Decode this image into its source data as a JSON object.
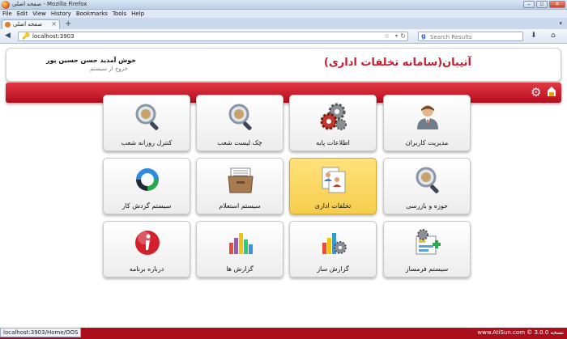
{
  "window": {
    "title": "صفحه اصلی - Mozilla Firefox",
    "minimize": "–",
    "maximize": "▫",
    "close": "✕"
  },
  "menu": [
    "File",
    "Edit",
    "View",
    "History",
    "Bookmarks",
    "Tools",
    "Help"
  ],
  "tab": {
    "label": "صفحه اصلی",
    "close": "×",
    "new_tab": "+",
    "list": "▾"
  },
  "nav": {
    "back": "◀",
    "url": "localhost:3903",
    "search_placeholder": "Search Results",
    "download": "⬇",
    "home": "⌂"
  },
  "header": {
    "brand": "آتیبان(سامانه تخلفات اداری)",
    "welcome": "خوش آمدید حسن حسین پور",
    "logout": "خروج از سیستم"
  },
  "tiles": [
    {
      "label": "مدیریت کاربران",
      "icon": "user-manager-icon"
    },
    {
      "label": "اطلاعات پایه",
      "icon": "gears-icon"
    },
    {
      "label": "چک لیست شعب",
      "icon": "magnifier-icon"
    },
    {
      "label": "کنترل روزانه شعب",
      "icon": "magnifier-icon"
    },
    {
      "label": "حوزه و بازرسی",
      "icon": "magnifier-icon"
    },
    {
      "label": "تخلفات اداری",
      "icon": "documents-users-icon",
      "active": true
    },
    {
      "label": "سیستم استعلام",
      "icon": "file-box-icon"
    },
    {
      "label": "سیستم گردش کار",
      "icon": "workflow-arrows-icon"
    },
    {
      "label": "سیستم فرمساز",
      "icon": "form-builder-icon"
    },
    {
      "label": "گزارش ساز",
      "icon": "report-builder-icon"
    },
    {
      "label": "گزارش ها",
      "icon": "bar-chart-icon"
    },
    {
      "label": "درباره برنامه",
      "icon": "info-icon"
    }
  ],
  "status": {
    "url": "localhost:3903/Home/OOS",
    "version": "نسخه 3.0.0 © www.AtiSun.com"
  },
  "colors": {
    "brand_red": "#c81a2b",
    "bar_red": "#b40c1c",
    "active_tile": "#f6cd4d"
  }
}
